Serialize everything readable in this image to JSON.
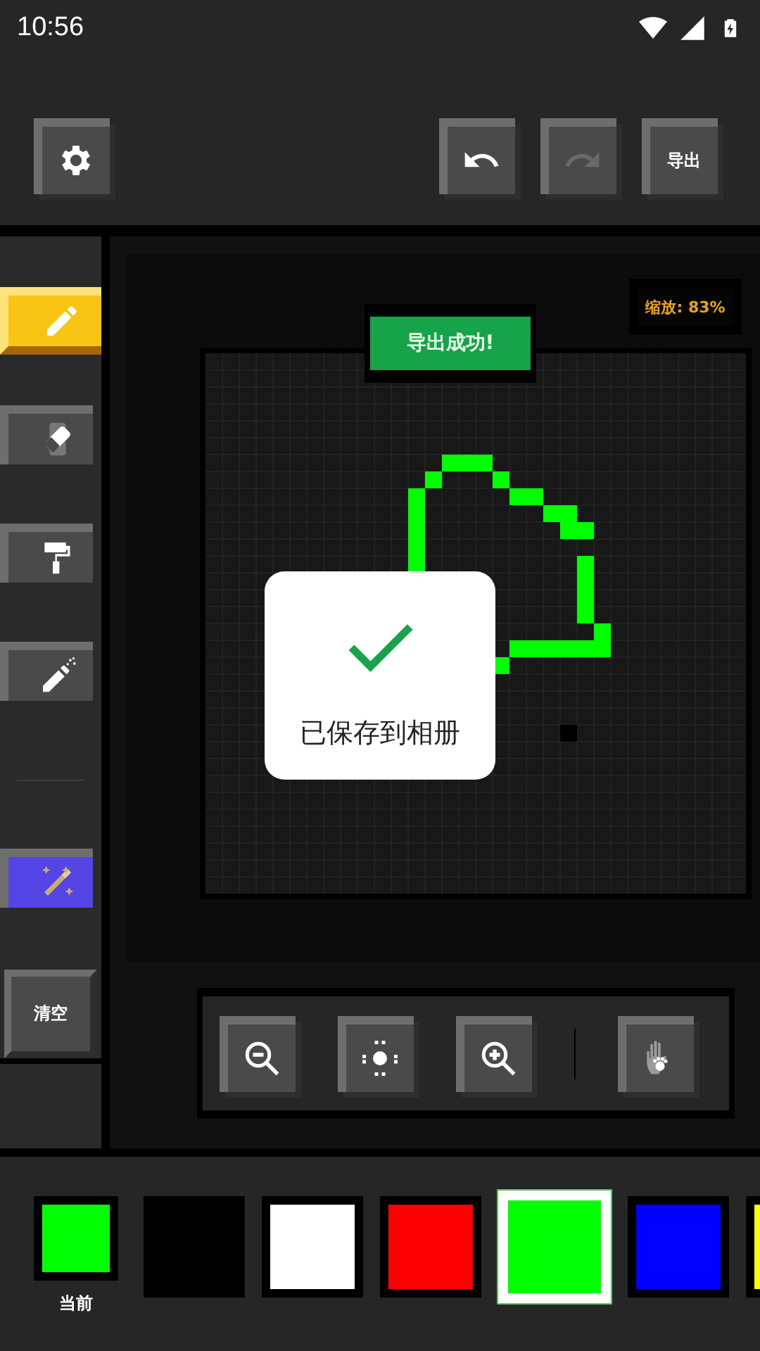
{
  "status_bar": {
    "time": "10:56"
  },
  "toolbar": {
    "buttons": [
      {
        "kind": "settings",
        "disabled": false
      },
      {
        "kind": "undo",
        "disabled": false
      },
      {
        "kind": "redo",
        "disabled": true
      },
      {
        "kind": "text",
        "label": "导出",
        "disabled": false
      }
    ]
  },
  "tools": [
    {
      "kind": "pencil",
      "selected": true
    },
    {
      "kind": "eraser",
      "selected": false
    },
    {
      "kind": "roller",
      "selected": false
    },
    {
      "kind": "spray",
      "selected": false
    },
    {
      "kind": "divider"
    },
    {
      "kind": "magic",
      "selected": false
    }
  ],
  "clear_button": {
    "label": "清空"
  },
  "zoom_badge": {
    "text": "缩放: 83%"
  },
  "export_toast": {
    "text": "导出成功!"
  },
  "saved_dialog": {
    "text": "已保存到相册"
  },
  "view_controls": [
    {
      "kind": "zoom-out"
    },
    {
      "kind": "center"
    },
    {
      "kind": "zoom-in"
    },
    {
      "kind": "separator"
    },
    {
      "kind": "hand"
    }
  ],
  "palette": {
    "current": {
      "color": "#00ff00",
      "label": "当前"
    },
    "swatches": [
      {
        "color": "#000000",
        "selected": false
      },
      {
        "color": "#ffffff",
        "selected": false
      },
      {
        "color": "#ff0000",
        "selected": false
      },
      {
        "color": "#00ff00",
        "selected": true
      },
      {
        "color": "#0000ff",
        "selected": false
      },
      {
        "color": "#ffff00",
        "selected": false
      }
    ]
  }
}
